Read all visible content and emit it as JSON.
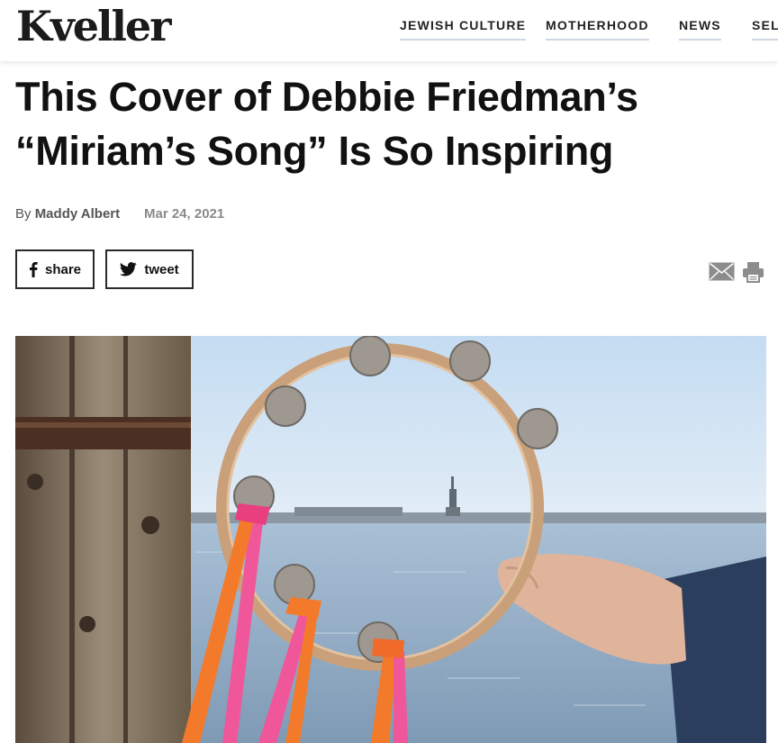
{
  "site": {
    "logo_text": "Kveller"
  },
  "nav": {
    "items": [
      {
        "label": "JEWISH CULTURE"
      },
      {
        "label": "MOTHERHOOD"
      },
      {
        "label": "NEWS"
      },
      {
        "label": "SELF"
      }
    ]
  },
  "article": {
    "title": "This Cover of Debbie Friedman’s “Miriam’s Song” Is So Inspiring",
    "byline_prefix": "By",
    "author": "Maddy Albert",
    "date": "Mar 24, 2021"
  },
  "share": {
    "facebook_label": "share",
    "twitter_label": "tweet"
  },
  "icons": {
    "facebook": "facebook-icon",
    "twitter": "twitter-icon",
    "email": "email-icon",
    "print": "print-icon"
  },
  "colors": {
    "text": "#111111",
    "nav_underline": "#cfd8e2",
    "meta_gray": "#8a8a8a",
    "icon_gray": "#8c8c8c"
  }
}
